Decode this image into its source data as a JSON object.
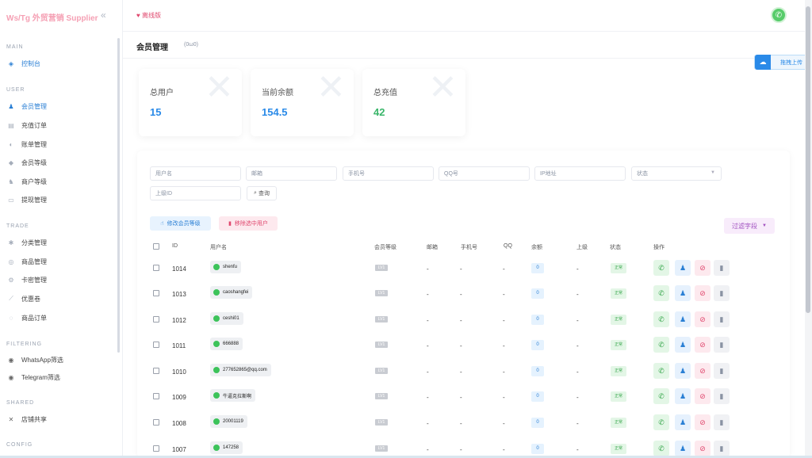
{
  "brand": {
    "title": "Ws/Tg 外贸营销 Supplier",
    "collapse_icon": "«"
  },
  "sidebar": {
    "sections": [
      {
        "label": "MAIN",
        "items": [
          {
            "label": "控制台",
            "icon": "eye-icon"
          }
        ]
      },
      {
        "label": "USER",
        "items": [
          {
            "label": "会员管理",
            "icon": "user-icon",
            "active": true
          },
          {
            "label": "充值订单",
            "icon": "card-icon"
          },
          {
            "label": "账单管理",
            "icon": "bill-icon"
          },
          {
            "label": "会员等级",
            "icon": "level-icon"
          },
          {
            "label": "商户等级",
            "icon": "merchant-icon"
          },
          {
            "label": "提现管理",
            "icon": "withdraw-icon"
          }
        ]
      },
      {
        "label": "TRADE",
        "items": [
          {
            "label": "分类管理",
            "icon": "category-icon"
          },
          {
            "label": "商品管理",
            "icon": "goods-icon"
          },
          {
            "label": "卡密管理",
            "icon": "key-icon"
          },
          {
            "label": "优惠卷",
            "icon": "coupon-icon"
          },
          {
            "label": "商品订单",
            "icon": "order-icon"
          }
        ]
      },
      {
        "label": "FILTERING",
        "items": [
          {
            "label": "WhatsApp筛选",
            "icon": "filter-icon"
          },
          {
            "label": "Telegram筛选",
            "icon": "filter-icon"
          }
        ]
      },
      {
        "label": "SHARED",
        "items": [
          {
            "label": "店铺共享",
            "icon": "share-icon"
          }
        ]
      },
      {
        "label": "CONFIG",
        "items": []
      }
    ]
  },
  "topbar": {
    "offline_label": "离线版"
  },
  "page": {
    "title": "会员管理",
    "subtitle": "(0ω0)"
  },
  "upload": {
    "label": "拖拽上传"
  },
  "stats": [
    {
      "label": "总用户",
      "value": "15",
      "color": "#2a8ae8"
    },
    {
      "label": "当前余额",
      "value": "154.5",
      "color": "#2a8ae8"
    },
    {
      "label": "总充值",
      "value": "42",
      "color": "#3ab66a"
    }
  ],
  "filters": {
    "username": "用户名",
    "email": "邮箱",
    "phone": "手机号",
    "qq": "QQ号",
    "ip": "IP地址",
    "status": "状态",
    "parent_id": "上级ID",
    "query_button": "查询"
  },
  "actions": {
    "edit_level": "修改会员等级",
    "remove_selected": "移除选中用户",
    "filter_fields": "过滤字段"
  },
  "table": {
    "headers": {
      "id": "ID",
      "username": "用户名",
      "level": "会员等级",
      "email": "邮箱",
      "phone": "手机号",
      "qq": "QQ",
      "balance": "余额",
      "parent": "上级",
      "status": "状态",
      "ops": "操作"
    },
    "rows": [
      {
        "id": "1014",
        "username": "shenfu",
        "level": "LV1",
        "email": "-",
        "phone": "-",
        "qq": "-",
        "balance": "0",
        "parent": "-",
        "status": "正常"
      },
      {
        "id": "1013",
        "username": "caoshangfei",
        "level": "LV1",
        "email": "-",
        "phone": "-",
        "qq": "-",
        "balance": "0",
        "parent": "-",
        "status": "正常"
      },
      {
        "id": "1012",
        "username": "ceshi01",
        "level": "LV1",
        "email": "-",
        "phone": "-",
        "qq": "-",
        "balance": "0",
        "parent": "-",
        "status": "正常"
      },
      {
        "id": "1011",
        "username": "666888",
        "level": "LV1",
        "email": "-",
        "phone": "-",
        "qq": "-",
        "balance": "0",
        "parent": "-",
        "status": "正常"
      },
      {
        "id": "1010",
        "username": "277652865@qq.com",
        "level": "LV1",
        "email": "-",
        "phone": "-",
        "qq": "-",
        "balance": "0",
        "parent": "-",
        "status": "正常"
      },
      {
        "id": "1009",
        "username": "牛逼克拉斯啊",
        "level": "LV1",
        "email": "-",
        "phone": "-",
        "qq": "-",
        "balance": "0",
        "parent": "-",
        "status": "正常"
      },
      {
        "id": "1008",
        "username": "20001119",
        "level": "LV1",
        "email": "-",
        "phone": "-",
        "qq": "-",
        "balance": "0",
        "parent": "-",
        "status": "正常"
      },
      {
        "id": "1007",
        "username": "147258",
        "level": "LV1",
        "email": "-",
        "phone": "-",
        "qq": "-",
        "balance": "0",
        "parent": "-",
        "status": "正常"
      }
    ]
  }
}
